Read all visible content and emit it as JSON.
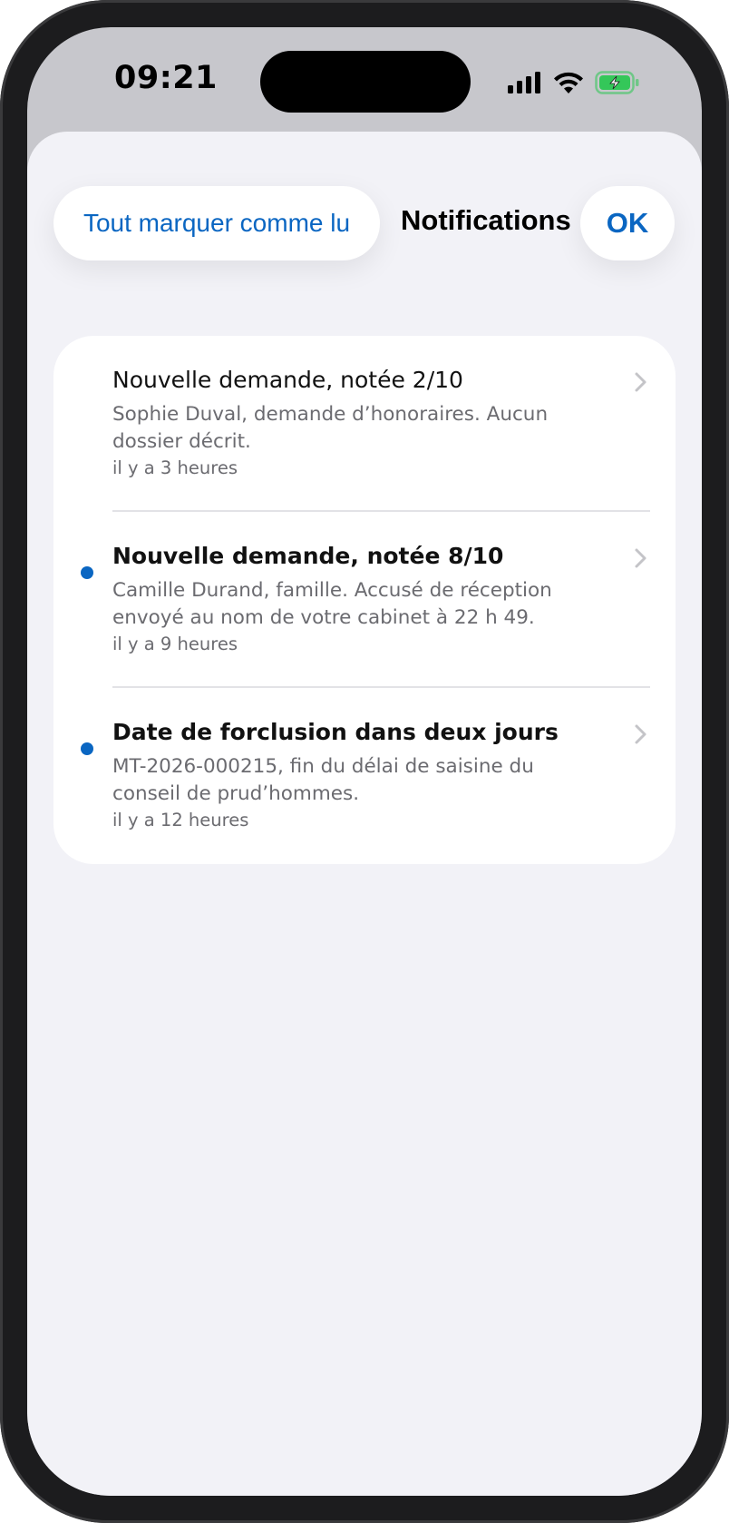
{
  "status_bar": {
    "time": "09:21",
    "icons": [
      "cellular-signal-icon",
      "wifi-icon",
      "battery-charging-icon"
    ]
  },
  "nav": {
    "mark_all_label": "Tout marquer comme lu",
    "title": "Notifications",
    "ok_label": "OK"
  },
  "colors": {
    "accent": "#0a66c2",
    "battery": "#34c759"
  },
  "notifications": [
    {
      "title": "Nouvelle demande, notée 2/10",
      "body": "Sophie Duval, demande d’honoraires. Aucun dossier décrit.",
      "time": "il y a 3 heures",
      "unread": false
    },
    {
      "title": "Nouvelle demande, notée 8/10",
      "body": "Camille Durand, famille. Accusé de réception envoyé au nom de votre cabinet à 22 h 49.",
      "time": "il y a 9 heures",
      "unread": true
    },
    {
      "title": "Date de forclusion dans deux jours",
      "body": "MT-2026-000215, fin du délai de saisine du conseil de prud’hommes.",
      "time": "il y a 12 heures",
      "unread": true
    }
  ]
}
